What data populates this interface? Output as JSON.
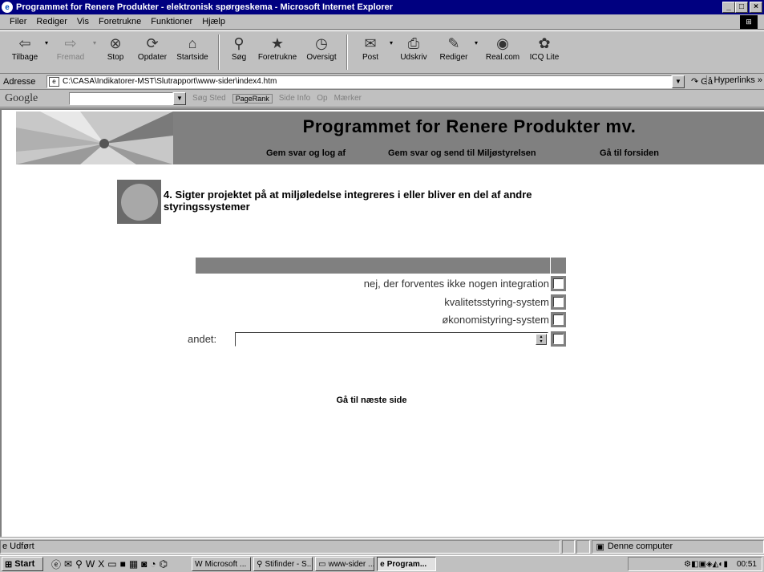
{
  "window": {
    "title": "Programmet for Renere Produkter - elektronisk spørgeskema - Microsoft Internet Explorer",
    "min": "_",
    "max": "□",
    "close": "×"
  },
  "menu": [
    "Filer",
    "Rediger",
    "Vis",
    "Foretrukne",
    "Funktioner",
    "Hjælp"
  ],
  "toolbar": [
    {
      "label": "Tilbage",
      "icon": "back-icon",
      "glyph": "⇦"
    },
    {
      "label": "Fremad",
      "icon": "forward-icon",
      "glyph": "⇨"
    },
    {
      "label": "Stop",
      "icon": "stop-icon",
      "glyph": "⊗"
    },
    {
      "label": "Opdater",
      "icon": "refresh-icon",
      "glyph": "⟳"
    },
    {
      "label": "Startside",
      "icon": "home-icon",
      "glyph": "⌂"
    },
    {
      "label": "Søg",
      "icon": "search-icon",
      "glyph": "⚲"
    },
    {
      "label": "Foretrukne",
      "icon": "favorites-icon",
      "glyph": "★"
    },
    {
      "label": "Oversigt",
      "icon": "history-icon",
      "glyph": "◷"
    },
    {
      "label": "Post",
      "icon": "mail-icon",
      "glyph": "✉"
    },
    {
      "label": "Udskriv",
      "icon": "print-icon",
      "glyph": "⎙"
    },
    {
      "label": "Rediger",
      "icon": "edit-icon",
      "glyph": "✎"
    },
    {
      "label": "Real.com",
      "icon": "realcom-icon",
      "glyph": "◉"
    },
    {
      "label": "ICQ Lite",
      "icon": "icq-icon",
      "glyph": "✿"
    }
  ],
  "address": {
    "label": "Adresse",
    "url": "C:\\CASA\\Indikatorer-MST\\Slutrapport\\www-sider\\index4.htm",
    "go": "Gå",
    "links": "Hyperlinks »"
  },
  "google": {
    "logo": "Google",
    "search_site": "Søg Sted",
    "pagerank": "PageRank",
    "page_info": "Side Info",
    "up": "Op",
    "highlight": "Mærker"
  },
  "page": {
    "banner_title": "Programmet for Renere Produkter mv.",
    "nav": [
      "Gem svar og log af",
      "Gem svar og send til Miljøstyrelsen",
      "Gå til forsiden"
    ],
    "question": "4. Sigter projektet på at miljøledelse integreres i eller bliver en del af andre styringssystemer",
    "options": [
      "nej, der forventes ikke nogen integration",
      "kvalitetsstyring-system",
      "økonomistyring-system"
    ],
    "other_label": "andet:",
    "other_value": "",
    "next": "Gå til næste side"
  },
  "status": {
    "text": "Udført",
    "zone": "Denne computer"
  },
  "taskbar": {
    "start": "Start",
    "tasks": [
      "Microsoft ...",
      "Stifinder - S...",
      "www-sider ...",
      "Program..."
    ],
    "clock": "00:51"
  }
}
